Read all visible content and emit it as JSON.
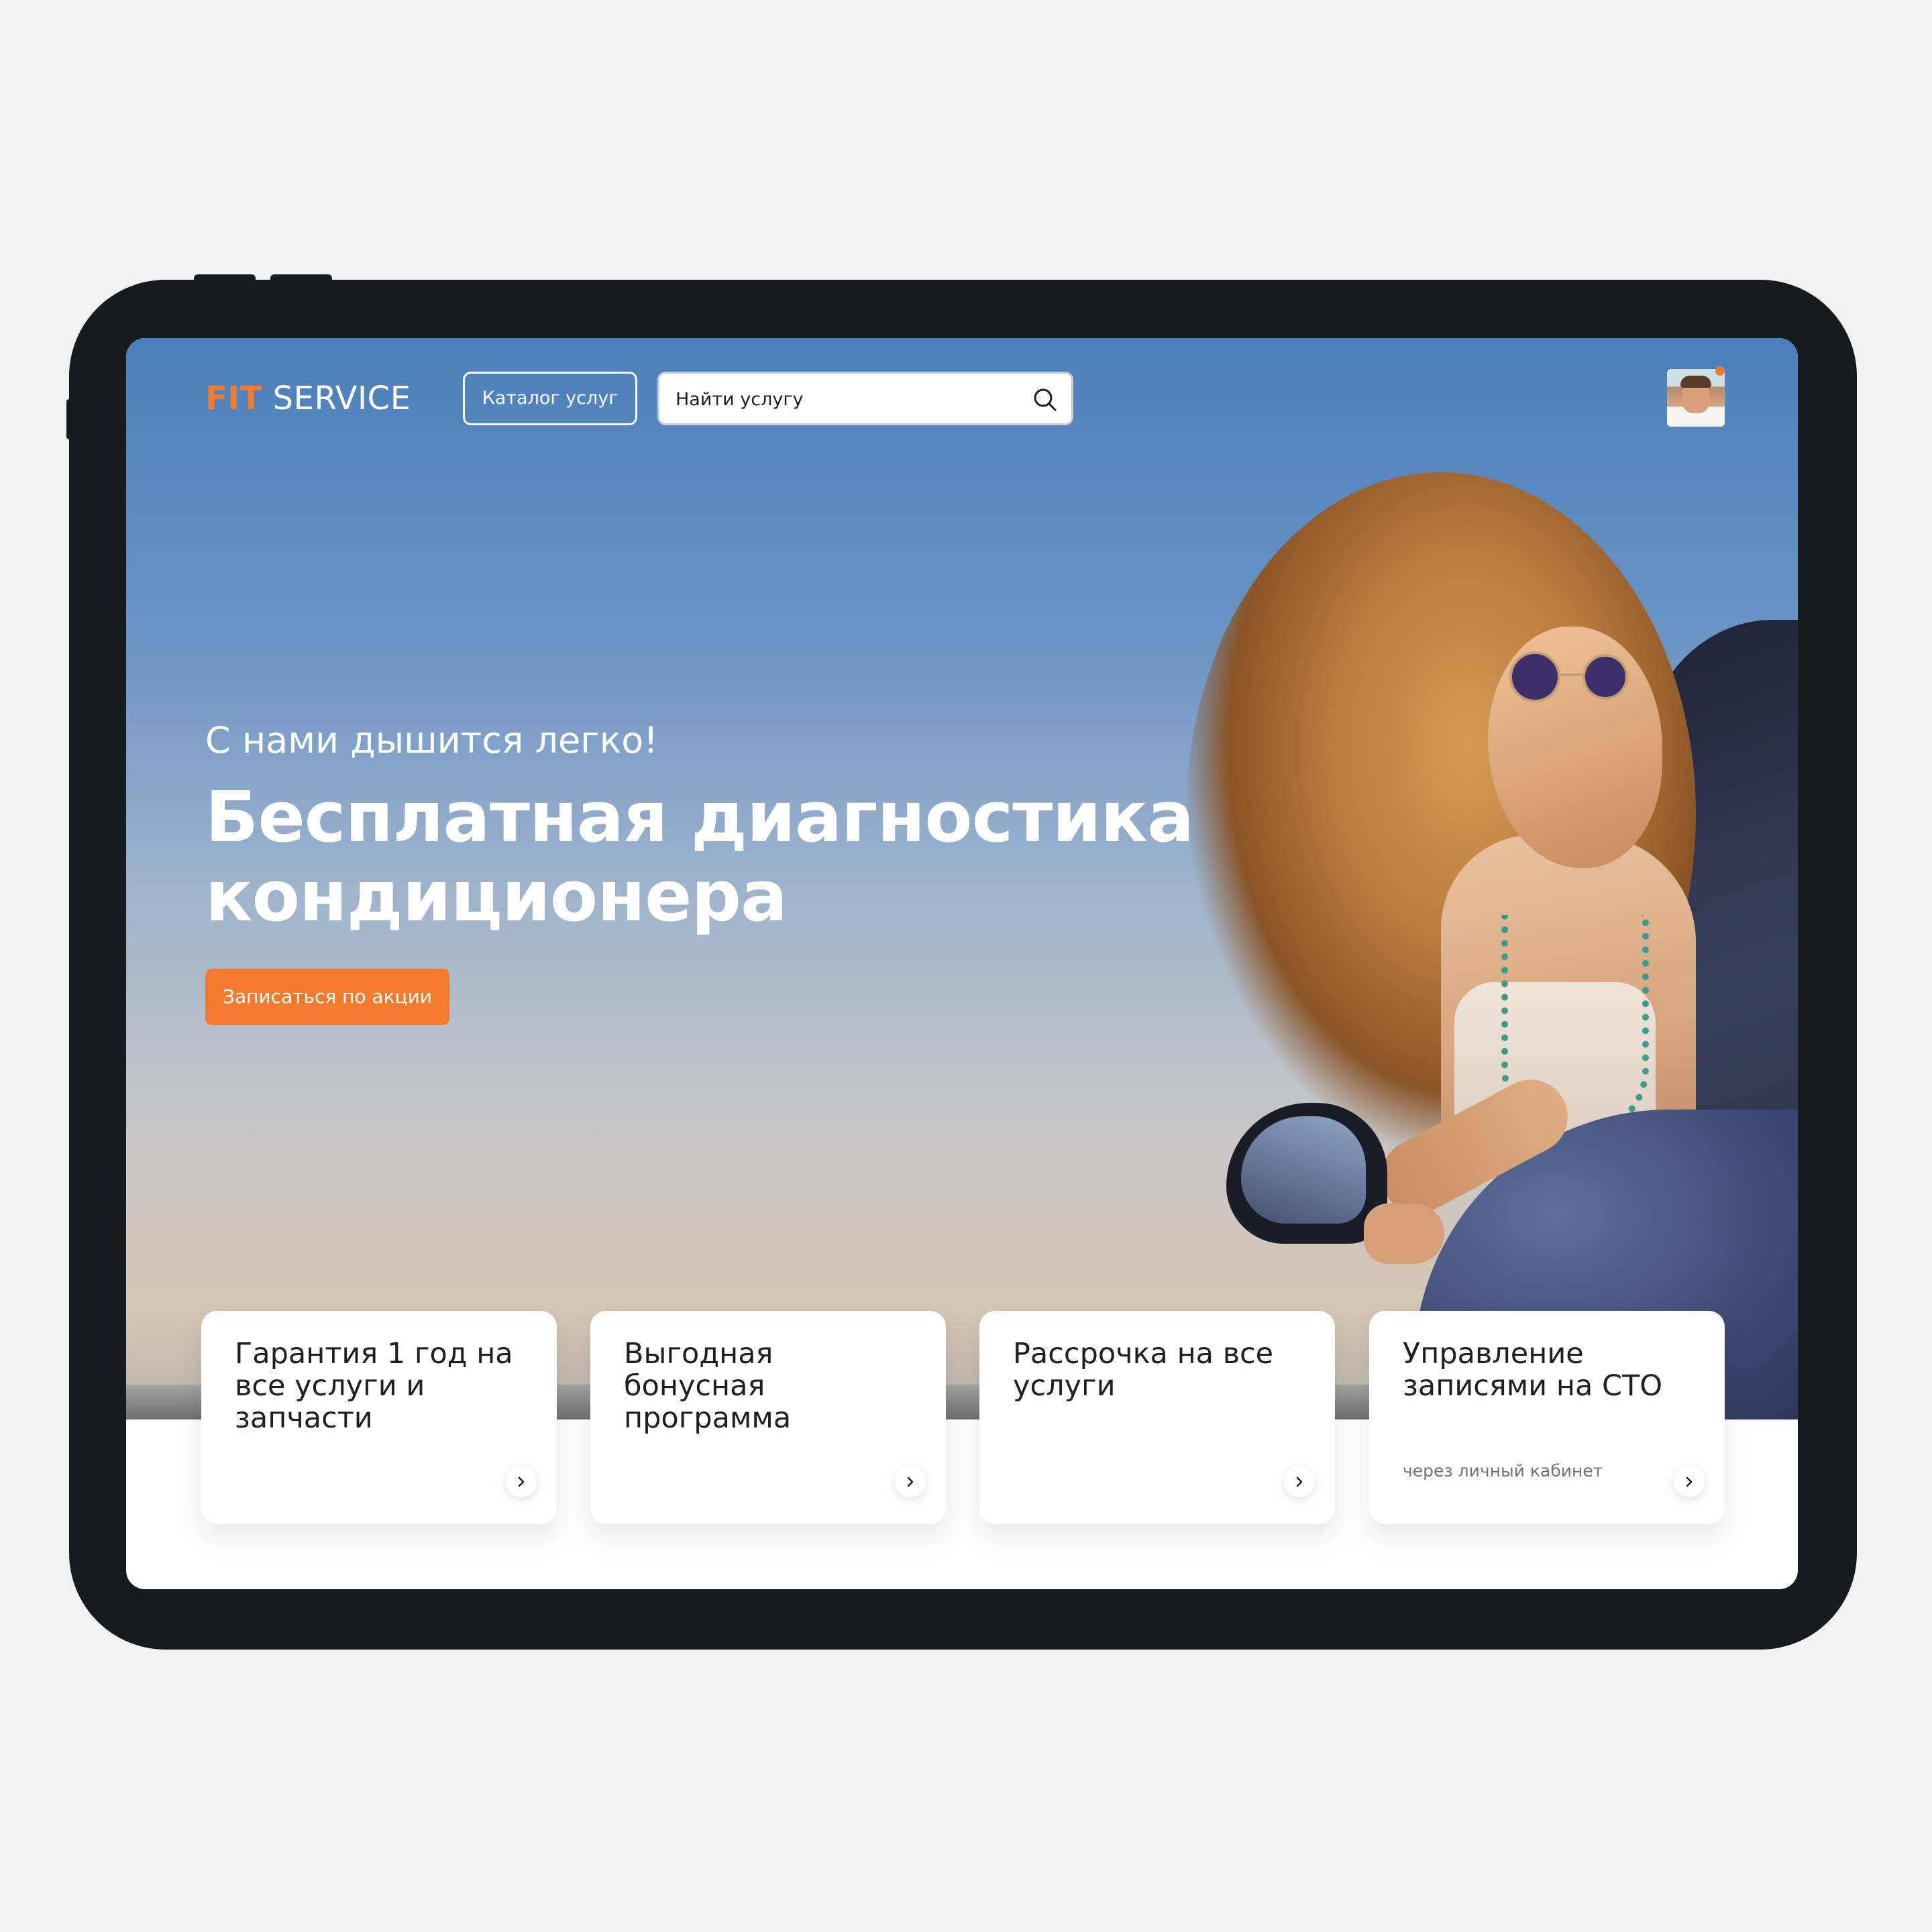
{
  "header": {
    "logo_accent": "FIT",
    "logo_rest": "SERVICE",
    "catalog_label": "Каталог услуг",
    "search_placeholder": "Найти услугу"
  },
  "hero": {
    "subtitle": "С нами дышится легко!",
    "headline": "Бесплатная диагностика кондиционера",
    "cta_label": "Записаться по акции"
  },
  "features": [
    {
      "title": "Гарантия 1 год на все услуги и запчасти",
      "note": ""
    },
    {
      "title": "Выгодная бонусная программа",
      "note": ""
    },
    {
      "title": "Рассрочка на все услуги",
      "note": ""
    },
    {
      "title": "Управление записями на СТО",
      "note": "через личный кабинет"
    }
  ],
  "colors": {
    "accent": "#f37b2f",
    "frame": "#161b1f",
    "page_bg": "#f2f2f2",
    "text_dark": "#1d1f24"
  },
  "icons": [
    "search-icon",
    "chevron-right-icon",
    "notification-dot"
  ]
}
